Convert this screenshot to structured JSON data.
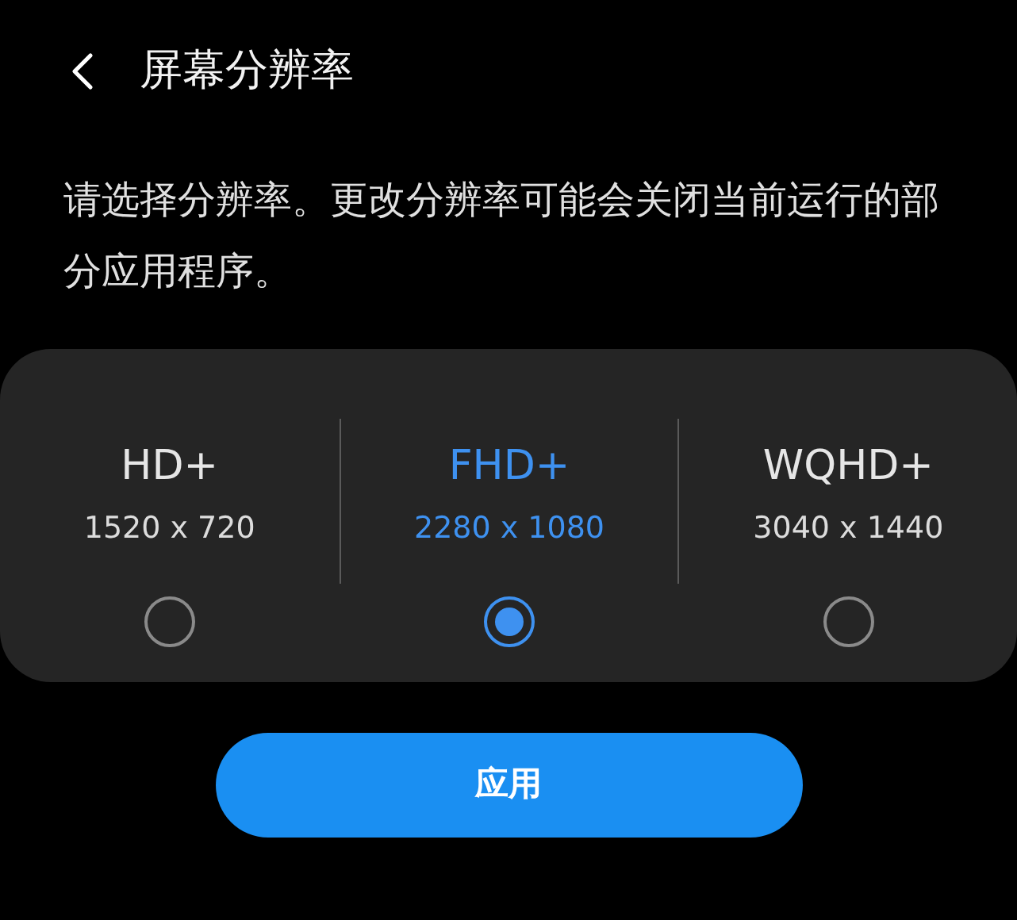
{
  "header": {
    "title": "屏幕分辨率"
  },
  "description": "请选择分辨率。更改分辨率可能会关闭当前运行的部分应用程序。",
  "options": [
    {
      "label": "HD+",
      "resolution": "1520 x 720",
      "selected": false
    },
    {
      "label": "FHD+",
      "resolution": "2280 x 1080",
      "selected": true
    },
    {
      "label": "WQHD+",
      "resolution": "3040 x 1440",
      "selected": false
    }
  ],
  "apply_button": "应用"
}
